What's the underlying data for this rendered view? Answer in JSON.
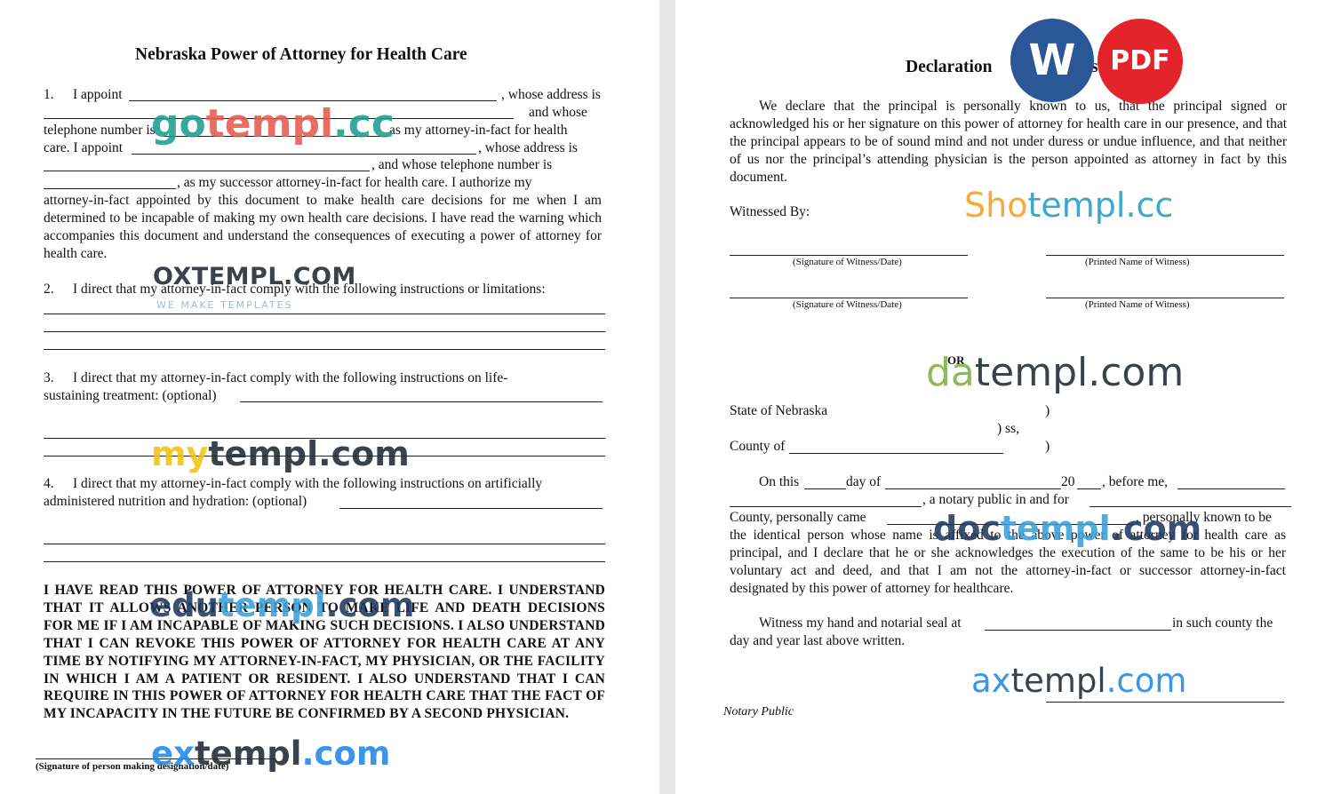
{
  "left": {
    "title": "Nebraska Power of Attorney for Health Care",
    "p1": {
      "num": "1.",
      "l1a": "I appoint",
      "l1b": ", whose address is",
      "l2": "and whose",
      "l3a": "telephone number is",
      "l3b": "as  my  attorney-in-fact for health",
      "l4a": "care. I appoint",
      "l4b": ", whose address is",
      "l5": ",   and whose telephone number is",
      "l6": ", as my  successor attorney-in-fact for health  care. I authorize my",
      "rest": "attorney-in-fact appointed by this document to make health care decisions for me when I am determined to be incapable of making my own health care decisions. I have read  the warning which accompanies this document and understand the consequences of executing a power of attorney for health care."
    },
    "p2": {
      "num": "2.",
      "text": "I direct that my attorney-in-fact comply with the following instructions or limitations:"
    },
    "p3": {
      "num": "3.",
      "line1": "I direct that my attorney-in-fact comply with the following instructions on  life-",
      "line2": "sustaining treatment: (optional)"
    },
    "p4": {
      "num": "4.",
      "line1": "I direct that my attorney-in-fact comply with the following instructions on artificially",
      "line2": "administered nutrition and hydration: (optional)"
    },
    "acknowledgement": "I HAVE READ THIS POWER OF ATTORNEY FOR HEALTH CARE. I UNDERSTAND THAT IT ALLOWS ANOTHER PERSON TO MAKE LIFE AND DEATH DECISIONS FOR ME IF I AM INCAPABLE OF MAKING SUCH DECISIONS. I ALSO UNDERSTAND THAT I CAN REVOKE THIS POWER OF ATTORNEY FOR HEALTH CARE AT ANY TIME BY NOTIFYING MY ATTORNEY-IN-FACT, MY PHYSICIAN, OR THE FACILITY IN WHICH I AM A PATIENT OR RESIDENT. I ALSO UNDERSTAND THAT I CAN REQUIRE IN THIS POWER OF ATTORNEY FOR HEALTH CARE THAT THE FACT OF MY INCAPACITY IN THE FUTURE BE CONFIRMED BY A SECOND PHYSICIAN.",
    "signature_caption": "(Signature of person making designation/date)"
  },
  "right": {
    "title_start": "Declaration",
    "title_end": "s",
    "declaration": "We declare that the principal is personally known to us, that the principal signed or acknowledged his or her signature on this power of attorney for health care in our presence, and that the principal appears to be of sound mind and not under duress or undue influence, and that neither of us nor the principal’s attending physician is the person appointed as attorney in fact by this document.",
    "witnessed_by": "Witnessed By:",
    "sig_witness_caption": "(Signature of Witness/Date)",
    "printed_witness_caption": "(Printed Name of Witness)",
    "or": "OR",
    "state": "State of Nebraska",
    "paren": ")",
    "ss": ") ss,",
    "county": "County of",
    "on_this": "On this",
    "day_of": "day of",
    "year": "20",
    "before_me": ", before me,",
    "notary_in": ", a notary public in and for",
    "county_came": "County,  personally came",
    "known_to": ", personally known to   be",
    "notary_rest": "the identical person whose name is affixed to the above power of attorney for health care as principal, and I declare that he or she acknowledges the execution of the same to be his or her voluntary act and deed, and that I am not the attorney-in-fact or successor attorney-in-fact designated by this power of attorney for healthcare.",
    "witness_hand": "Witness my hand and notarial seal at",
    "in_such": "in such county the",
    "day_year": "day and year last above written.",
    "notary_public": "Notary Public"
  },
  "badges": {
    "word": "W",
    "pdf": "PDF"
  },
  "watermarks": {
    "gotempl": [
      "go",
      "templ",
      ".cc"
    ],
    "oxtempl": "OXTEMPL.COM",
    "oxtempl_tag": "WE MAKE TEMPLATES",
    "mytempl": [
      "my",
      "templ.com"
    ],
    "edutempl": [
      "edu",
      "templ",
      ".com"
    ],
    "extempl": [
      "ex",
      "templ",
      ".com"
    ],
    "shotempl": [
      "Sho",
      "templ",
      ".cc"
    ],
    "datempl": [
      "da",
      "templ.com"
    ],
    "doctempl": [
      "doc",
      "templ",
      ".com"
    ],
    "axtempl": [
      "ax",
      "templ",
      ".com"
    ]
  },
  "colors": {
    "word_blue": "#2b5797",
    "pdf_red": "#e3242b",
    "teal": "#1e9e8e",
    "orange": "#f4a020",
    "green": "#7cb342",
    "dark": "#1f2933",
    "blue": "#1e88e5"
  }
}
